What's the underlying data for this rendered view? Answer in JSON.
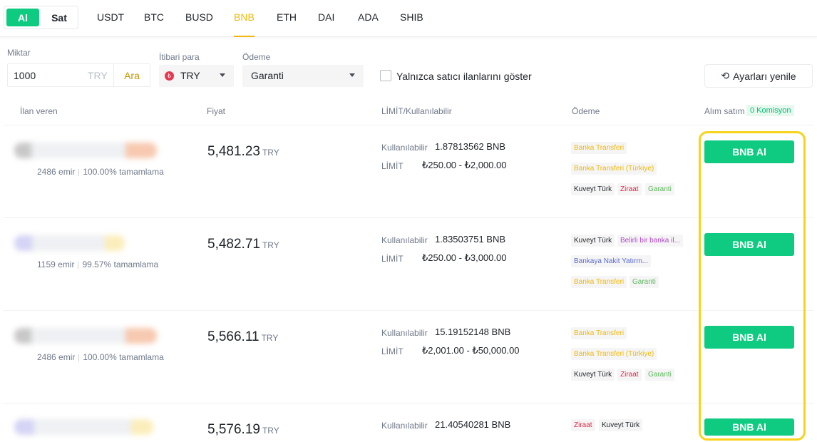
{
  "trade_toggle": {
    "buy": "Al",
    "sell": "Sat"
  },
  "coins": [
    "USDT",
    "BTC",
    "BUSD",
    "BNB",
    "ETH",
    "DAI",
    "ADA",
    "SHIB"
  ],
  "active_coin": "BNB",
  "filters": {
    "amount_label": "Miktar",
    "amount_value": "1000",
    "amount_unit": "TRY",
    "search_label": "Ara",
    "fiat_label": "İtibari para",
    "fiat_value": "TRY",
    "payment_label": "Ödeme",
    "payment_value": "Garanti",
    "merchant_only_label": "Yalnızca satıcı ilanlarını göster",
    "reset_label": "Ayarları yenile"
  },
  "headers": {
    "advertiser": "İlan veren",
    "price": "Fiyat",
    "limit": "LİMİT/Kullanılabilir",
    "payment": "Ödeme",
    "trade": "Alım satım",
    "commission": "0 Komisyon"
  },
  "labels": {
    "available": "Kullanılabilir",
    "limit": "LİMİT",
    "price_currency": "TRY",
    "buy_button": "BNB Al"
  },
  "ads": [
    {
      "orders": "2486 emir",
      "completion": "100.00% tamamlama",
      "price": "5,481.23",
      "available": "1.87813562 BNB",
      "limit": "₺250.00 - ₺2,000.00",
      "payments": [
        "Banka Transferi",
        "Banka Transferi (Türkiye)",
        "Kuveyt Türk",
        "Ziraat",
        "Garanti"
      ]
    },
    {
      "orders": "1159 emir",
      "completion": "99.57% tamamlama",
      "price": "5,482.71",
      "available": "1.83503751 BNB",
      "limit": "₺250.00 - ₺3,000.00",
      "payments": [
        "Kuveyt Türk",
        "Belirli bir banka il...",
        "Bankaya Nakit Yatırm...",
        "Banka Transferi",
        "Garanti"
      ]
    },
    {
      "orders": "2486 emir",
      "completion": "100.00% tamamlama",
      "price": "5,566.11",
      "available": "15.19152148 BNB",
      "limit": "₺2,001.00 - ₺50,000.00",
      "payments": [
        "Banka Transferi",
        "Banka Transferi (Türkiye)",
        "Kuveyt Türk",
        "Ziraat",
        "Garanti"
      ]
    },
    {
      "price": "5,576.19",
      "available": "21.40540281 BNB",
      "payments": [
        "Ziraat",
        "Kuveyt Türk"
      ]
    }
  ],
  "colors": {
    "accent": "#f0b90b",
    "buy": "#0ecb81",
    "highlight": "#f7d31c"
  }
}
